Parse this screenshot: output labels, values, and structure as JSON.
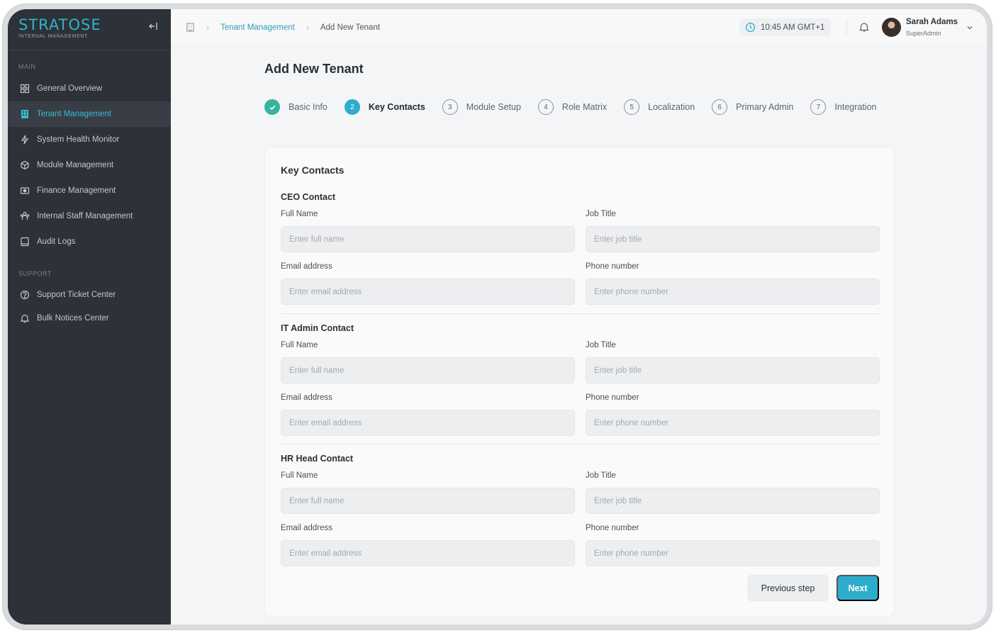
{
  "brand": {
    "name": "STRATOSE",
    "subtitle": "INTERNAL MANAGEMENT"
  },
  "sidebar": {
    "main_label": "MAIN",
    "items": [
      {
        "label": "General Overview",
        "icon": "grid-icon"
      },
      {
        "label": "Tenant Management",
        "icon": "building-icon",
        "active": true
      },
      {
        "label": "System Health Monitor",
        "icon": "bolt-icon"
      },
      {
        "label": "Module Management",
        "icon": "cube-icon"
      },
      {
        "label": "Finance Management",
        "icon": "money-icon"
      },
      {
        "label": "Internal Staff Management",
        "icon": "people-icon"
      },
      {
        "label": "Audit Logs",
        "icon": "log-icon"
      }
    ],
    "support_label": "SUPPORT",
    "support_items": [
      {
        "label": "Support Ticket Center",
        "icon": "help-circle-icon"
      },
      {
        "label": "Bulk Notices Center",
        "icon": "bell-icon"
      }
    ]
  },
  "topbar": {
    "breadcrumb": {
      "link": "Tenant Management",
      "current": "Add New Tenant"
    },
    "time": "10:45 AM GMT+1",
    "user": {
      "name": "Sarah Adams",
      "role": "SuperAdmin"
    }
  },
  "page": {
    "title": "Add New Tenant"
  },
  "stepper": [
    {
      "num": "",
      "label": "Basic Info",
      "state": "done"
    },
    {
      "num": "2",
      "label": "Key Contacts",
      "state": "active"
    },
    {
      "num": "3",
      "label": "Module Setup",
      "state": "pending"
    },
    {
      "num": "4",
      "label": "Role Matrix",
      "state": "pending"
    },
    {
      "num": "5",
      "label": "Localization",
      "state": "pending"
    },
    {
      "num": "6",
      "label": "Primary Admin",
      "state": "pending"
    },
    {
      "num": "7",
      "label": "Integration",
      "state": "pending"
    }
  ],
  "form": {
    "title": "Key Contacts",
    "labels": {
      "full_name": "Full Name",
      "job_title": "Job Title",
      "email": "Email address",
      "phone": "Phone number"
    },
    "placeholders": {
      "full_name": "Enter full name",
      "job_title": "Enter job title",
      "email": "Enter email address",
      "phone": "Enter phone number"
    },
    "groups": [
      {
        "title": "CEO Contact"
      },
      {
        "title": "IT Admin Contact"
      },
      {
        "title": "HR Head Contact"
      }
    ],
    "prev_label": "Previous step",
    "next_label": "Next"
  },
  "colors": {
    "accent": "#2eaccc",
    "sidebar_bg": "#2d3138",
    "done": "#36b3a0"
  }
}
